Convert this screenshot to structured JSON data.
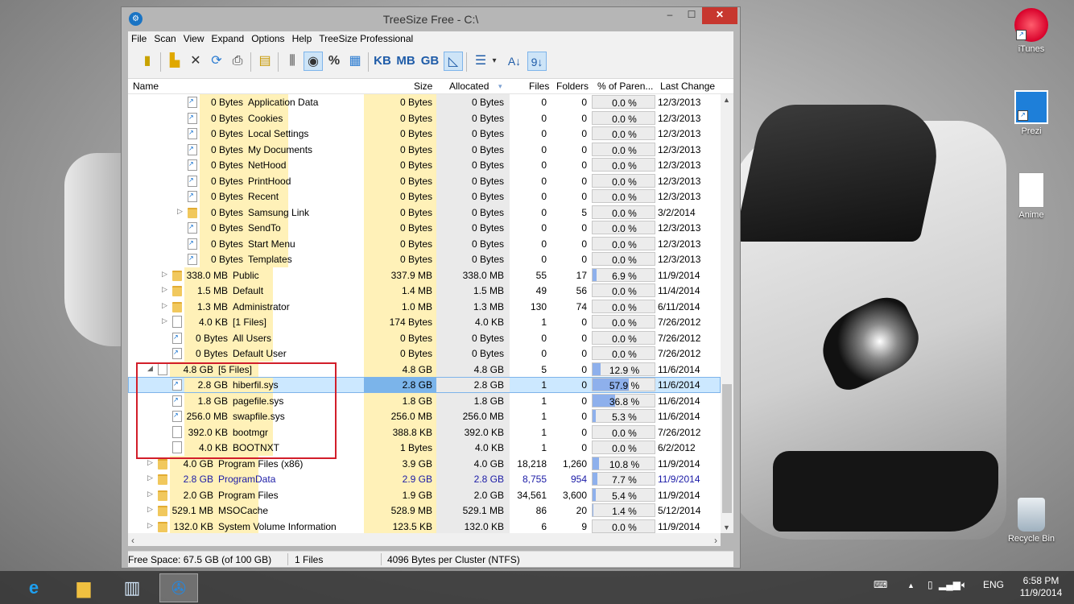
{
  "desktop": {
    "icons": [
      {
        "label": "iTunes"
      },
      {
        "label": "Prezi"
      },
      {
        "label": "Anime"
      },
      {
        "label": "Recycle Bin"
      }
    ]
  },
  "window": {
    "title": "TreeSize Free - C:\\",
    "controls": {
      "minimize": "‒",
      "maximize": "☐",
      "close": "✕"
    }
  },
  "menu": [
    "File",
    "Scan",
    "View",
    "Expand",
    "Options",
    "Help",
    "TreeSize Professional"
  ],
  "toolbar": {
    "units": [
      "KB",
      "MB",
      "GB"
    ],
    "percent": "%"
  },
  "columns": {
    "name": "Name",
    "size": "Size",
    "allocated": "Allocated",
    "files": "Files",
    "folders": "Folders",
    "percent_parent": "% of Paren...",
    "last_change": "Last Change"
  },
  "rows": [
    {
      "indent": 3,
      "icon": "link",
      "expander": "",
      "name_size": "0 Bytes",
      "name": "Application Data",
      "size": "0 Bytes",
      "allocated": "0 Bytes",
      "files": "0",
      "folders": "0",
      "pct": "0.0 %",
      "pct_value": 0.0,
      "last_change": "12/3/2013"
    },
    {
      "indent": 3,
      "icon": "link",
      "expander": "",
      "name_size": "0 Bytes",
      "name": "Cookies",
      "size": "0 Bytes",
      "allocated": "0 Bytes",
      "files": "0",
      "folders": "0",
      "pct": "0.0 %",
      "pct_value": 0.0,
      "last_change": "12/3/2013"
    },
    {
      "indent": 3,
      "icon": "link",
      "expander": "",
      "name_size": "0 Bytes",
      "name": "Local Settings",
      "size": "0 Bytes",
      "allocated": "0 Bytes",
      "files": "0",
      "folders": "0",
      "pct": "0.0 %",
      "pct_value": 0.0,
      "last_change": "12/3/2013"
    },
    {
      "indent": 3,
      "icon": "link",
      "expander": "",
      "name_size": "0 Bytes",
      "name": "My Documents",
      "size": "0 Bytes",
      "allocated": "0 Bytes",
      "files": "0",
      "folders": "0",
      "pct": "0.0 %",
      "pct_value": 0.0,
      "last_change": "12/3/2013"
    },
    {
      "indent": 3,
      "icon": "link",
      "expander": "",
      "name_size": "0 Bytes",
      "name": "NetHood",
      "size": "0 Bytes",
      "allocated": "0 Bytes",
      "files": "0",
      "folders": "0",
      "pct": "0.0 %",
      "pct_value": 0.0,
      "last_change": "12/3/2013"
    },
    {
      "indent": 3,
      "icon": "link",
      "expander": "",
      "name_size": "0 Bytes",
      "name": "PrintHood",
      "size": "0 Bytes",
      "allocated": "0 Bytes",
      "files": "0",
      "folders": "0",
      "pct": "0.0 %",
      "pct_value": 0.0,
      "last_change": "12/3/2013"
    },
    {
      "indent": 3,
      "icon": "link",
      "expander": "",
      "name_size": "0 Bytes",
      "name": "Recent",
      "size": "0 Bytes",
      "allocated": "0 Bytes",
      "files": "0",
      "folders": "0",
      "pct": "0.0 %",
      "pct_value": 0.0,
      "last_change": "12/3/2013"
    },
    {
      "indent": 3,
      "icon": "folder",
      "expander": "▷",
      "name_size": "0 Bytes",
      "name": "Samsung Link",
      "size": "0 Bytes",
      "allocated": "0 Bytes",
      "files": "0",
      "folders": "5",
      "pct": "0.0 %",
      "pct_value": 0.0,
      "last_change": "3/2/2014"
    },
    {
      "indent": 3,
      "icon": "link",
      "expander": "",
      "name_size": "0 Bytes",
      "name": "SendTo",
      "size": "0 Bytes",
      "allocated": "0 Bytes",
      "files": "0",
      "folders": "0",
      "pct": "0.0 %",
      "pct_value": 0.0,
      "last_change": "12/3/2013"
    },
    {
      "indent": 3,
      "icon": "link",
      "expander": "",
      "name_size": "0 Bytes",
      "name": "Start Menu",
      "size": "0 Bytes",
      "allocated": "0 Bytes",
      "files": "0",
      "folders": "0",
      "pct": "0.0 %",
      "pct_value": 0.0,
      "last_change": "12/3/2013"
    },
    {
      "indent": 3,
      "icon": "link",
      "expander": "",
      "name_size": "0 Bytes",
      "name": "Templates",
      "size": "0 Bytes",
      "allocated": "0 Bytes",
      "files": "0",
      "folders": "0",
      "pct": "0.0 %",
      "pct_value": 0.0,
      "last_change": "12/3/2013"
    },
    {
      "indent": 2,
      "icon": "folder",
      "expander": "▷",
      "name_size": "338.0 MB",
      "name": "Public",
      "size": "337.9 MB",
      "allocated": "338.0 MB",
      "files": "55",
      "folders": "17",
      "pct": "6.9 %",
      "pct_value": 6.9,
      "last_change": "11/9/2014"
    },
    {
      "indent": 2,
      "icon": "folder",
      "expander": "▷",
      "name_size": "1.5 MB",
      "name": "Default",
      "size": "1.4 MB",
      "allocated": "1.5 MB",
      "files": "49",
      "folders": "56",
      "pct": "0.0 %",
      "pct_value": 0.0,
      "last_change": "11/4/2014"
    },
    {
      "indent": 2,
      "icon": "folder",
      "expander": "▷",
      "name_size": "1.3 MB",
      "name": "Administrator",
      "size": "1.0 MB",
      "allocated": "1.3 MB",
      "files": "130",
      "folders": "74",
      "pct": "0.0 %",
      "pct_value": 0.0,
      "last_change": "6/11/2014"
    },
    {
      "indent": 2,
      "icon": "file",
      "expander": "▷",
      "name_size": "4.0 KB",
      "name": "[1 Files]",
      "size": "174 Bytes",
      "allocated": "4.0 KB",
      "files": "1",
      "folders": "0",
      "pct": "0.0 %",
      "pct_value": 0.0,
      "last_change": "7/26/2012"
    },
    {
      "indent": 2,
      "icon": "link",
      "expander": "",
      "name_size": "0 Bytes",
      "name": "All Users",
      "size": "0 Bytes",
      "allocated": "0 Bytes",
      "files": "0",
      "folders": "0",
      "pct": "0.0 %",
      "pct_value": 0.0,
      "last_change": "7/26/2012"
    },
    {
      "indent": 2,
      "icon": "link",
      "expander": "",
      "name_size": "0 Bytes",
      "name": "Default User",
      "size": "0 Bytes",
      "allocated": "0 Bytes",
      "files": "0",
      "folders": "0",
      "pct": "0.0 %",
      "pct_value": 0.0,
      "last_change": "7/26/2012"
    },
    {
      "indent": 1,
      "icon": "file",
      "expander": "◢",
      "name_size": "4.8 GB",
      "name": "[5 Files]",
      "size": "4.8 GB",
      "allocated": "4.8 GB",
      "files": "5",
      "folders": "0",
      "pct": "12.9 %",
      "pct_value": 12.9,
      "last_change": "11/6/2014"
    },
    {
      "indent": 2,
      "icon": "link",
      "expander": "",
      "name_size": "2.8 GB",
      "name": "hiberfil.sys",
      "size": "2.8 GB",
      "allocated": "2.8 GB",
      "files": "1",
      "folders": "0",
      "pct": "57.9 %",
      "pct_value": 57.9,
      "last_change": "11/6/2014",
      "selected": true
    },
    {
      "indent": 2,
      "icon": "link",
      "expander": "",
      "name_size": "1.8 GB",
      "name": "pagefile.sys",
      "size": "1.8 GB",
      "allocated": "1.8 GB",
      "files": "1",
      "folders": "0",
      "pct": "36.8 %",
      "pct_value": 36.8,
      "last_change": "11/6/2014"
    },
    {
      "indent": 2,
      "icon": "link",
      "expander": "",
      "name_size": "256.0 MB",
      "name": "swapfile.sys",
      "size": "256.0 MB",
      "allocated": "256.0 MB",
      "files": "1",
      "folders": "0",
      "pct": "5.3 %",
      "pct_value": 5.3,
      "last_change": "11/6/2014"
    },
    {
      "indent": 2,
      "icon": "file",
      "expander": "",
      "name_size": "392.0 KB",
      "name": "bootmgr",
      "size": "388.8 KB",
      "allocated": "392.0 KB",
      "files": "1",
      "folders": "0",
      "pct": "0.0 %",
      "pct_value": 0.0,
      "last_change": "7/26/2012"
    },
    {
      "indent": 2,
      "icon": "file",
      "expander": "",
      "name_size": "4.0 KB",
      "name": "BOOTNXT",
      "size": "1 Bytes",
      "allocated": "4.0 KB",
      "files": "1",
      "folders": "0",
      "pct": "0.0 %",
      "pct_value": 0.0,
      "last_change": "6/2/2012"
    },
    {
      "indent": 1,
      "icon": "folder",
      "expander": "▷",
      "name_size": "4.0 GB",
      "name": "Program Files (x86)",
      "size": "3.9 GB",
      "allocated": "4.0 GB",
      "files": "18,218",
      "folders": "1,260",
      "pct": "10.8 %",
      "pct_value": 10.8,
      "last_change": "11/9/2014"
    },
    {
      "indent": 1,
      "icon": "folder",
      "expander": "▷",
      "name_size": "2.8 GB",
      "name": "ProgramData",
      "size": "2.9 GB",
      "allocated": "2.8 GB",
      "files": "8,755",
      "folders": "954",
      "pct": "7.7 %",
      "pct_value": 7.7,
      "last_change": "11/9/2014",
      "blue": true
    },
    {
      "indent": 1,
      "icon": "folder",
      "expander": "▷",
      "name_size": "2.0 GB",
      "name": "Program Files",
      "size": "1.9 GB",
      "allocated": "2.0 GB",
      "files": "34,561",
      "folders": "3,600",
      "pct": "5.4 %",
      "pct_value": 5.4,
      "last_change": "11/9/2014"
    },
    {
      "indent": 1,
      "icon": "folder",
      "expander": "▷",
      "name_size": "529.1 MB",
      "name": "MSOCache",
      "size": "528.9 MB",
      "allocated": "529.1 MB",
      "files": "86",
      "folders": "20",
      "pct": "1.4 %",
      "pct_value": 1.4,
      "last_change": "5/12/2014"
    },
    {
      "indent": 1,
      "icon": "folder",
      "expander": "▷",
      "name_size": "132.0 KB",
      "name": "System Volume Information",
      "size": "123.5 KB",
      "allocated": "132.0 KB",
      "files": "6",
      "folders": "9",
      "pct": "0.0 %",
      "pct_value": 0.0,
      "last_change": "11/9/2014"
    }
  ],
  "status": {
    "free_space": "Free Space: 67.5 GB  (of 100 GB)",
    "files": "1  Files",
    "cluster": "4096 Bytes per Cluster (NTFS)"
  },
  "taskbar": {
    "lang": "ENG",
    "time": "6:58 PM",
    "date": "11/9/2014"
  },
  "colors": {
    "selection": "#cce8ff",
    "size_highlight": "#fff1b8",
    "percent_bar": "#8eb0ec",
    "annotation_box": "#d21e2a",
    "close_button": "#c7372f"
  }
}
